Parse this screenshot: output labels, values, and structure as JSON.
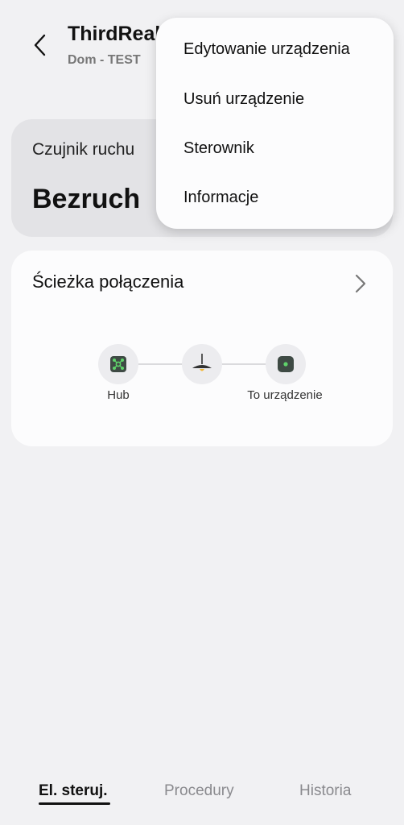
{
  "header": {
    "title": "ThirdReality",
    "subtitle": "Dom - TEST"
  },
  "status_card": {
    "label": "Czujnik ruchu",
    "value": "Bezruch"
  },
  "connection_card": {
    "title": "Ścieżka połączenia",
    "nodes": [
      {
        "label": "Hub",
        "icon": "hub-icon"
      },
      {
        "label": "",
        "icon": "lamp-icon"
      },
      {
        "label": "To urządzenie",
        "icon": "device-icon"
      }
    ]
  },
  "menu": {
    "items": [
      "Edytowanie urządzenia",
      "Usuń urządzenie",
      "Sterownik",
      "Informacje"
    ]
  },
  "tabs": [
    {
      "label": "El. steruj.",
      "active": true
    },
    {
      "label": "Procedury",
      "active": false
    },
    {
      "label": "Historia",
      "active": false
    }
  ],
  "colors": {
    "background": "#f1f1f3",
    "card": "#fcfcfd",
    "status_card": "#e3e3e6",
    "accent_green": "#5fd36a"
  }
}
